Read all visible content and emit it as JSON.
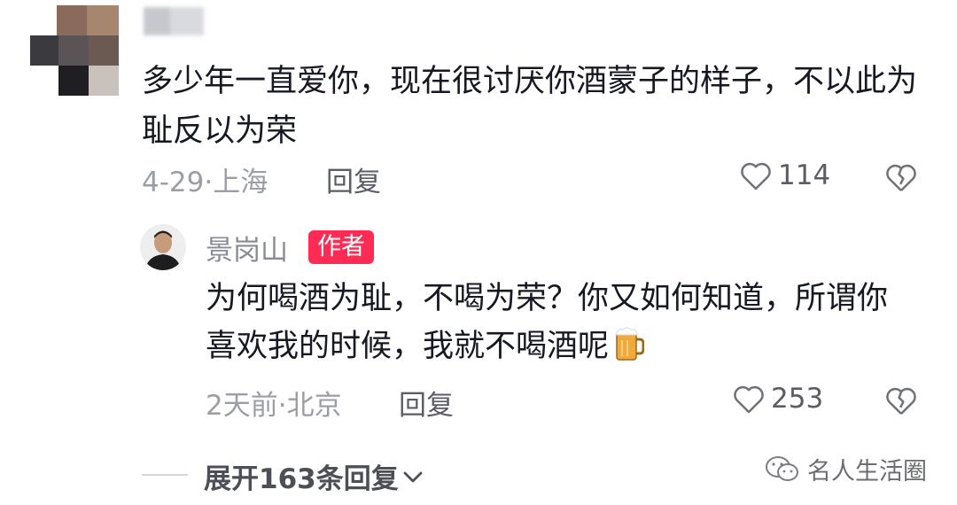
{
  "comment": {
    "text": "多少年一直爱你，现在很讨厌你酒蒙子的样子，不以此为耻反以为荣",
    "date_location": "4-29·上海",
    "reply_label": "回复",
    "likes": "114"
  },
  "reply": {
    "author": "景岗山",
    "badge": "作者",
    "text": "为何喝酒为耻，不喝为荣？你又如何知道，所谓你喜欢我的时候，我就不喝酒呢",
    "date_location": "2天前·北京",
    "reply_label": "回复",
    "likes": "253"
  },
  "expand_label": "展开163条回复",
  "watermark": "名人生活圈",
  "colors": {
    "badge": "#fe2c55",
    "text": "#161823",
    "meta": "#9b9ea6"
  }
}
